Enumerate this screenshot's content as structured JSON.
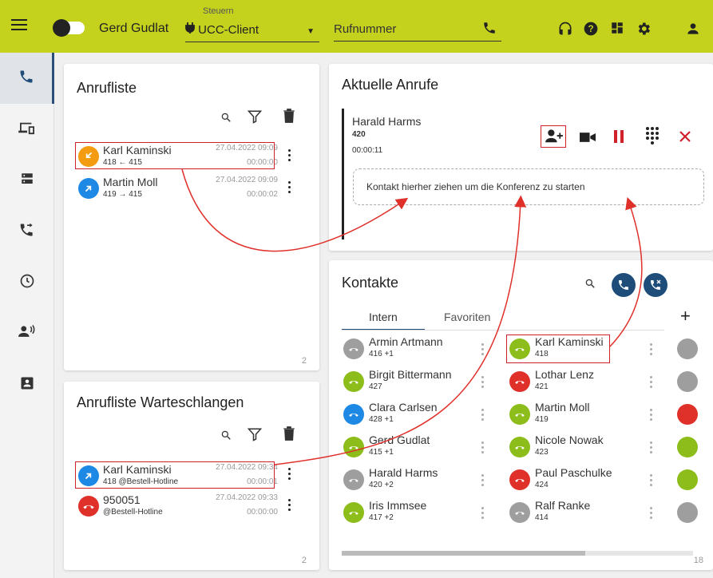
{
  "topbar": {
    "user_name": "Gerd Gudlat",
    "control_caption": "Steuern",
    "control_value": "UCC-Client",
    "phone_placeholder": "Rufnummer"
  },
  "colors": {
    "topbar": "#c5d21d",
    "accent_blue": "#1e4d7a",
    "orange": "#f39c12",
    "green": "#8cbd1a",
    "red": "#e0302a",
    "grey": "#9e9e9e",
    "highlight": "#d0202a"
  },
  "sidebar": {
    "items": [
      {
        "icon": "phone-icon"
      },
      {
        "icon": "devices-icon"
      },
      {
        "icon": "server-icon"
      },
      {
        "icon": "call-forward-icon"
      },
      {
        "icon": "clock-icon"
      },
      {
        "icon": "voicemail-speaker-icon"
      },
      {
        "icon": "contact-card-icon"
      }
    ]
  },
  "anrufliste": {
    "title": "Anrufliste",
    "count": "2",
    "entries": [
      {
        "name": "Karl Kaminski",
        "detail": "418 ← 415",
        "date": "27.04.2022 09:09",
        "duration": "00:00:00",
        "status": "orange"
      },
      {
        "name": "Martin Moll",
        "detail": "419 → 415",
        "date": "27.04.2022 09:09",
        "duration": "00:00:02",
        "status": "blue"
      }
    ]
  },
  "warteschlangen": {
    "title": "Anrufliste Warteschlangen",
    "count": "2",
    "entries": [
      {
        "name": "Karl Kaminski",
        "detail": "418 @Bestell-Hotline",
        "date": "27.04.2022 09:34",
        "duration": "00:00:01",
        "status": "blue"
      },
      {
        "name": "950051",
        "detail": "@Bestell-Hotline",
        "date": "27.04.2022 09:33",
        "duration": "00:00:00",
        "status": "red"
      }
    ]
  },
  "aktuelle_anrufe": {
    "title": "Aktuelle Anrufe",
    "caller_name": "Harald Harms",
    "caller_number": "420",
    "call_time": "00:00:11",
    "dropzone_text": "Kontakt hierher ziehen um die Konferenz zu starten"
  },
  "kontakte": {
    "title": "Kontakte",
    "tabs": [
      "Intern",
      "Favoriten"
    ],
    "active_tab": "Intern",
    "add_label": "+",
    "count": "18",
    "col1": [
      {
        "name": "Armin Artmann",
        "detail": "416 +1",
        "status": "grey"
      },
      {
        "name": "Birgit Bittermann",
        "detail": "427",
        "status": "green"
      },
      {
        "name": "Clara Carlsen",
        "detail": "428 +1",
        "status": "blue"
      },
      {
        "name": "Gerd Gudlat",
        "detail": "415 +1",
        "status": "green"
      },
      {
        "name": "Harald Harms",
        "detail": "420 +2",
        "status": "grey"
      },
      {
        "name": "Iris Immsee",
        "detail": "417 +2",
        "status": "green"
      }
    ],
    "col2": [
      {
        "name": "Karl Kaminski",
        "detail": "418",
        "status": "green"
      },
      {
        "name": "Lothar Lenz",
        "detail": "421",
        "status": "red"
      },
      {
        "name": "Martin Moll",
        "detail": "419",
        "status": "green"
      },
      {
        "name": "Nicole Nowak",
        "detail": "423",
        "status": "green"
      },
      {
        "name": "Paul Paschulke",
        "detail": "424",
        "status": "red"
      },
      {
        "name": "Ralf Ranke",
        "detail": "414",
        "status": "grey"
      }
    ]
  }
}
